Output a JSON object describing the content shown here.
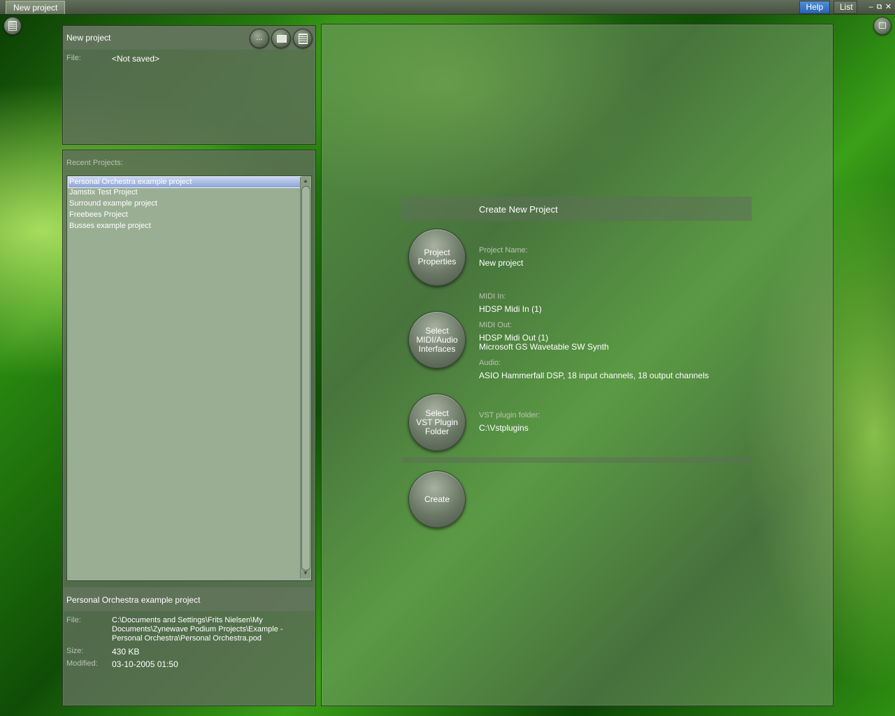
{
  "window": {
    "tab_title": "New project",
    "help_label": "Help",
    "list_label": "List",
    "minimize": "–",
    "restore": "⧉",
    "close": "✕"
  },
  "project_panel": {
    "title": "New project",
    "buttons": {
      "browse": "..."
    },
    "file_label": "File:",
    "file_value": "<Not saved>"
  },
  "recent": {
    "label": "Recent Projects:",
    "items": [
      "Personal Orchestra example project",
      "Jamstix Test Project",
      "Surround example project",
      "Freebees Project",
      "Busses example project"
    ],
    "selected_index": 0
  },
  "details": {
    "title": "Personal Orchestra example project",
    "file_label": "File:",
    "file_value": "C:\\Documents and Settings\\Frits Nielsen\\My Documents\\Zynewave Podium Projects\\Example - Personal Orchestra\\Personal Orchestra.pod",
    "size_label": "Size:",
    "size_value": "430 KB",
    "modified_label": "Modified:",
    "modified_value": "03-10-2005 01:50"
  },
  "create_panel": {
    "title": "Create New Project",
    "btn_properties": "Project\nProperties",
    "btn_interfaces": "Select\nMIDI/Audio\nInterfaces",
    "btn_vst": "Select\nVST Plugin\nFolder",
    "btn_create": "Create",
    "project_name_label": "Project Name:",
    "project_name_value": "New project",
    "midi_in_label": "MIDI In:",
    "midi_in_value": "HDSP Midi In (1)",
    "midi_out_label": "MIDI Out:",
    "midi_out_values": [
      "HDSP Midi Out (1)",
      "Microsoft GS Wavetable SW Synth"
    ],
    "audio_label": "Audio:",
    "audio_value": "ASIO Hammerfall DSP, 18 input channels, 18 output channels",
    "vst_label": "VST plugin folder:",
    "vst_value": "C:\\Vstplugins"
  }
}
